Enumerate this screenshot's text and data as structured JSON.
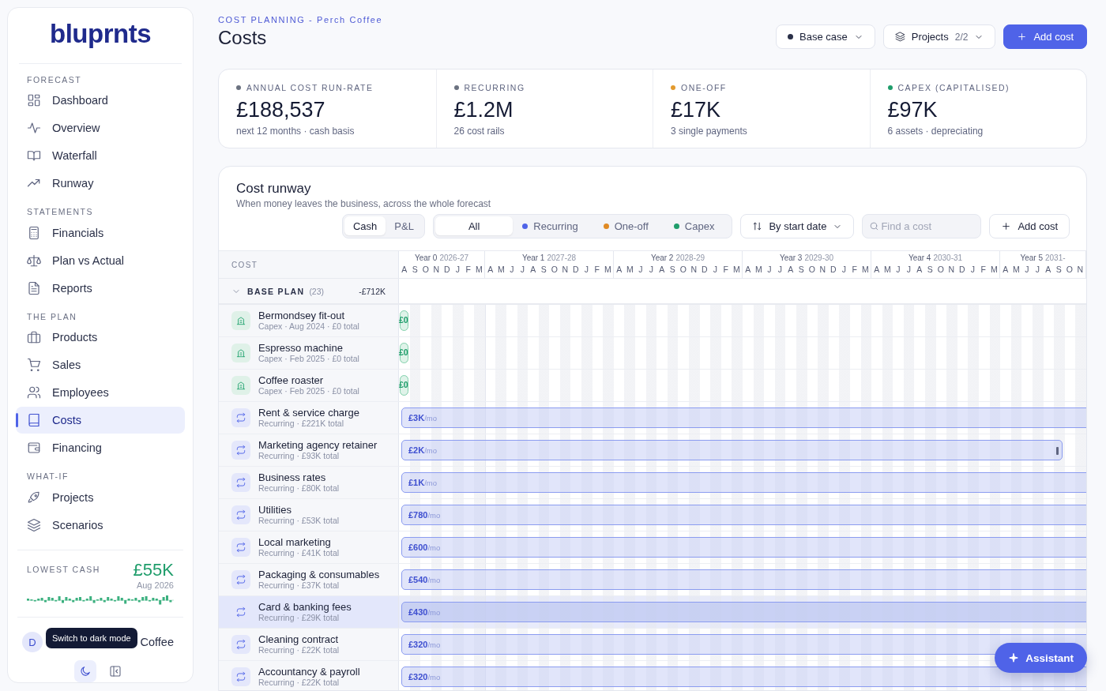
{
  "sidebar": {
    "logo": "bluprnts",
    "sections": [
      {
        "heading": "FORECAST",
        "items": [
          {
            "label": "Dashboard",
            "selected": false
          },
          {
            "label": "Overview",
            "selected": false
          },
          {
            "label": "Waterfall",
            "selected": false
          },
          {
            "label": "Runway",
            "selected": false
          }
        ]
      },
      {
        "heading": "STATEMENTS",
        "items": [
          {
            "label": "Financials",
            "selected": false
          },
          {
            "label": "Plan vs Actual",
            "selected": false
          },
          {
            "label": "Reports",
            "selected": false
          }
        ]
      },
      {
        "heading": "THE PLAN",
        "items": [
          {
            "label": "Products",
            "selected": false
          },
          {
            "label": "Sales",
            "selected": false
          },
          {
            "label": "Employees",
            "selected": false
          },
          {
            "label": "Costs",
            "selected": true
          },
          {
            "label": "Financing",
            "selected": false
          }
        ]
      },
      {
        "heading": "WHAT-IF",
        "items": [
          {
            "label": "Projects",
            "selected": false
          },
          {
            "label": "Scenarios",
            "selected": false
          }
        ]
      }
    ],
    "lowest_cash": {
      "label": "LOWEST CASH",
      "value": "£55K",
      "date": "Aug 2026"
    },
    "user": {
      "initial": "D",
      "name": "Coffee"
    },
    "tooltip": "Switch to dark mode"
  },
  "header": {
    "breadcrumb": "COST PLANNING - Perch Coffee",
    "title": "Costs",
    "scenario": "Base case",
    "projects": {
      "label": "Projects",
      "count": "2/2"
    },
    "add_button": "Add cost"
  },
  "kpis": [
    {
      "label": "ANNUAL COST RUN-RATE",
      "color": "#6b7280",
      "value": "£188,537",
      "note": "next 12 months · cash basis"
    },
    {
      "label": "RECURRING",
      "color": "#6b7280",
      "value": "£1.2M",
      "note": "26 cost rails"
    },
    {
      "label": "ONE-OFF",
      "color": "#e39a2e",
      "value": "£17K",
      "note": "3 single payments"
    },
    {
      "label": "CAPEX (CAPITALISED)",
      "color": "#1f9d6b",
      "value": "£97K",
      "note": "6 assets · depreciating"
    }
  ],
  "runway": {
    "title": "Cost runway",
    "subtitle": "When money leaves the business, across the whole forecast",
    "basis": [
      {
        "label": "Cash",
        "selected": true
      },
      {
        "label": "P&L",
        "selected": false
      }
    ],
    "filters": [
      {
        "label": "All",
        "selected": true
      },
      {
        "label": "Recurring",
        "color": "#4f63e8",
        "selected": false
      },
      {
        "label": "One-off",
        "color": "#e08a24",
        "selected": false
      },
      {
        "label": "Capex",
        "color": "#1f9d6b",
        "selected": false
      }
    ],
    "sort": "By start date",
    "search": {
      "placeholder": "Find a cost"
    },
    "add_button": "Add cost",
    "table": {
      "column": "COST",
      "years": [
        {
          "label": "Year 0",
          "span": "2026-27",
          "months": [
            "A",
            "S",
            "O",
            "N",
            "D",
            "J",
            "F",
            "M"
          ]
        },
        {
          "label": "Year 1",
          "span": "2027-28",
          "months": [
            "A",
            "M",
            "J",
            "J",
            "A",
            "S",
            "O",
            "N",
            "D",
            "J",
            "F",
            "M"
          ]
        },
        {
          "label": "Year 2",
          "span": "2028-29",
          "months": [
            "A",
            "M",
            "J",
            "J",
            "A",
            "S",
            "O",
            "N",
            "D",
            "J",
            "F",
            "M"
          ]
        },
        {
          "label": "Year 3",
          "span": "2029-30",
          "months": [
            "A",
            "M",
            "J",
            "J",
            "A",
            "S",
            "O",
            "N",
            "D",
            "J",
            "F",
            "M"
          ]
        },
        {
          "label": "Year 4",
          "span": "2030-31",
          "months": [
            "A",
            "M",
            "J",
            "J",
            "A",
            "S",
            "O",
            "N",
            "D",
            "J",
            "F",
            "M"
          ]
        },
        {
          "label": "Year 5",
          "span": "2031-",
          "months": [
            "A",
            "M",
            "J",
            "J",
            "A",
            "S",
            "O",
            "N"
          ]
        }
      ],
      "group": {
        "label": "BASE PLAN",
        "count": "(23)",
        "total": "-£712K",
        "expanded": true
      },
      "rows": [
        {
          "name": "Bermondsey fit-out",
          "kind": "capex",
          "meta": "Capex · Aug 2024 · £0 total",
          "bar": {
            "value": "£0"
          },
          "selected": false
        },
        {
          "name": "Espresso machine",
          "kind": "capex",
          "meta": "Capex · Feb 2025 · £0 total",
          "bar": {
            "value": "£0"
          },
          "selected": false
        },
        {
          "name": "Coffee roaster",
          "kind": "capex",
          "meta": "Capex · Feb 2025 · £0 total",
          "bar": {
            "value": "£0"
          },
          "selected": false
        },
        {
          "name": "Rent & service charge",
          "kind": "recurring",
          "meta": "Recurring · £221K total",
          "bar": {
            "value": "£3K",
            "unit": "/mo",
            "ends_in_view": false
          },
          "selected": false
        },
        {
          "name": "Marketing agency retainer",
          "kind": "recurring",
          "meta": "Recurring · £93K total",
          "bar": {
            "value": "£2K",
            "unit": "/mo",
            "ends_in_view": true
          },
          "selected": false
        },
        {
          "name": "Business rates",
          "kind": "recurring",
          "meta": "Recurring · £80K total",
          "bar": {
            "value": "£1K",
            "unit": "/mo",
            "ends_in_view": false
          },
          "selected": false
        },
        {
          "name": "Utilities",
          "kind": "recurring",
          "meta": "Recurring · £53K total",
          "bar": {
            "value": "£780",
            "unit": "/mo",
            "ends_in_view": false
          },
          "selected": false
        },
        {
          "name": "Local marketing",
          "kind": "recurring",
          "meta": "Recurring · £41K total",
          "bar": {
            "value": "£600",
            "unit": "/mo",
            "ends_in_view": false
          },
          "selected": false
        },
        {
          "name": "Packaging & consumables",
          "kind": "recurring",
          "meta": "Recurring · £37K total",
          "bar": {
            "value": "£540",
            "unit": "/mo",
            "ends_in_view": false
          },
          "selected": false
        },
        {
          "name": "Card & banking fees",
          "kind": "recurring",
          "meta": "Recurring · £29K total",
          "bar": {
            "value": "£430",
            "unit": "/mo",
            "ends_in_view": false
          },
          "selected": true
        },
        {
          "name": "Cleaning contract",
          "kind": "recurring",
          "meta": "Recurring · £22K total",
          "bar": {
            "value": "£320",
            "unit": "/mo",
            "ends_in_view": false
          },
          "selected": false
        },
        {
          "name": "Accountancy & payroll",
          "kind": "recurring",
          "meta": "Recurring · £22K total",
          "bar": {
            "value": "£320",
            "unit": "/mo",
            "ends_in_view": false
          },
          "selected": false
        }
      ]
    }
  },
  "assistant": "Assistant"
}
